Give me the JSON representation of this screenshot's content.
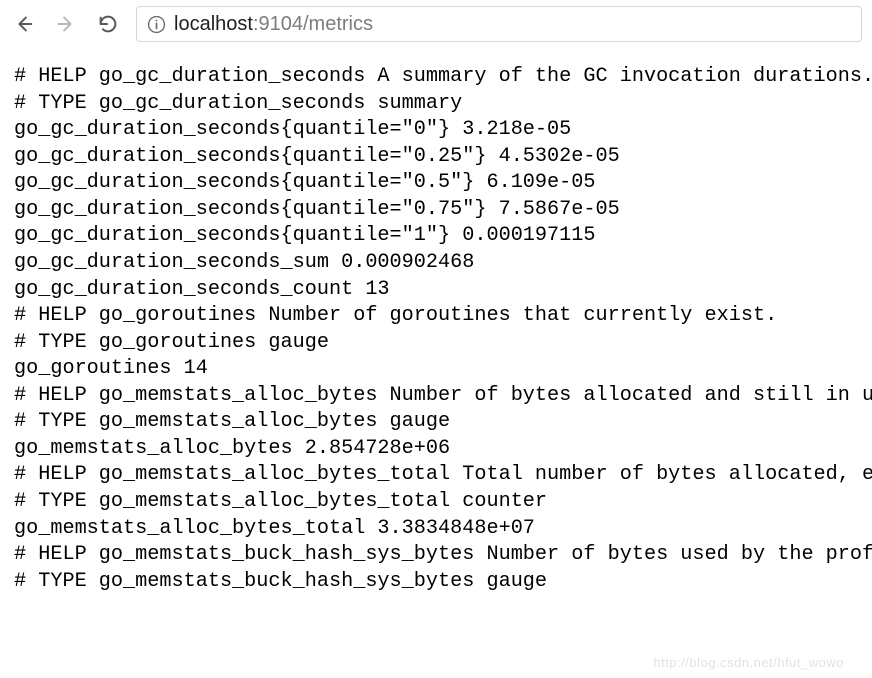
{
  "url": {
    "host": "localhost",
    "port": ":9104",
    "path": "/metrics"
  },
  "metrics": {
    "lines": [
      "# HELP go_gc_duration_seconds A summary of the GC invocation durations.",
      "# TYPE go_gc_duration_seconds summary",
      "go_gc_duration_seconds{quantile=\"0\"} 3.218e-05",
      "go_gc_duration_seconds{quantile=\"0.25\"} 4.5302e-05",
      "go_gc_duration_seconds{quantile=\"0.5\"} 6.109e-05",
      "go_gc_duration_seconds{quantile=\"0.75\"} 7.5867e-05",
      "go_gc_duration_seconds{quantile=\"1\"} 0.000197115",
      "go_gc_duration_seconds_sum 0.000902468",
      "go_gc_duration_seconds_count 13",
      "# HELP go_goroutines Number of goroutines that currently exist.",
      "# TYPE go_goroutines gauge",
      "go_goroutines 14",
      "# HELP go_memstats_alloc_bytes Number of bytes allocated and still in use.",
      "# TYPE go_memstats_alloc_bytes gauge",
      "go_memstats_alloc_bytes 2.854728e+06",
      "# HELP go_memstats_alloc_bytes_total Total number of bytes allocated, even if freed.",
      "# TYPE go_memstats_alloc_bytes_total counter",
      "go_memstats_alloc_bytes_total 3.3834848e+07",
      "# HELP go_memstats_buck_hash_sys_bytes Number of bytes used by the profiling bucket hash table.",
      "# TYPE go_memstats_buck_hash_sys_bytes gauge"
    ]
  },
  "watermark": "http://blog.csdn.net/hfut_wowo"
}
